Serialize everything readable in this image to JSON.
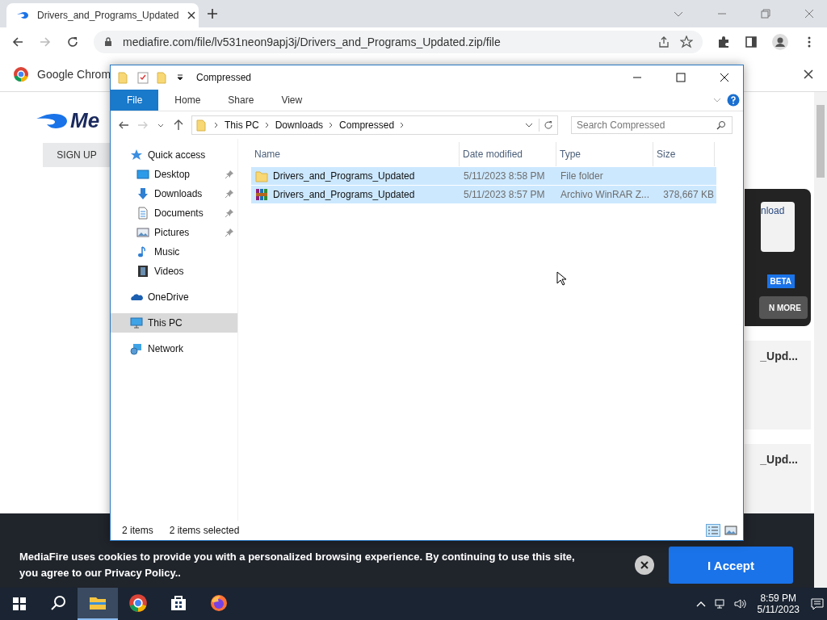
{
  "browser": {
    "tab": {
      "title": "Drivers_and_Programs_Updated"
    },
    "url": "mediafire.com/file/lv531neon9apj3j/Drivers_and_Programs_Updated.zip/file",
    "infobar": "Google Chrom"
  },
  "page": {
    "logo": "Me",
    "signup": "SIGN UP",
    "download": "nload",
    "beta": "BETA",
    "more": "N MORE",
    "cards": [
      {
        "name": "_Upd..."
      },
      {
        "name": "_Upd..."
      }
    ],
    "cookie": {
      "text": "MediaFire uses cookies to provide you with a personalized browsing experience. By continuing to use this site, you agree to our Privacy Policy..",
      "accept": "I Accept"
    }
  },
  "explorer": {
    "title": "Compressed",
    "ribbon_tabs": [
      {
        "label": "File",
        "selected": true
      },
      {
        "label": "Home",
        "selected": false
      },
      {
        "label": "Share",
        "selected": false
      },
      {
        "label": "View",
        "selected": false
      }
    ],
    "breadcrumb": [
      "This PC",
      "Downloads",
      "Compressed"
    ],
    "search": {
      "placeholder": "Search Compressed"
    },
    "nav": [
      {
        "label": "Quick access",
        "kind": "star",
        "selected": false,
        "children": [
          {
            "label": "Desktop",
            "kind": "desktop",
            "pinned": true,
            "selected": false
          },
          {
            "label": "Downloads",
            "kind": "download",
            "pinned": true,
            "selected": false
          },
          {
            "label": "Documents",
            "kind": "document",
            "pinned": true,
            "selected": false
          },
          {
            "label": "Pictures",
            "kind": "picture",
            "pinned": true,
            "selected": false
          },
          {
            "label": "Music",
            "kind": "music",
            "pinned": false,
            "selected": false
          },
          {
            "label": "Videos",
            "kind": "video",
            "pinned": false,
            "selected": false
          }
        ]
      },
      {
        "label": "OneDrive",
        "kind": "cloud",
        "selected": false
      },
      {
        "label": "This PC",
        "kind": "pc",
        "selected": true
      },
      {
        "label": "Network",
        "kind": "network",
        "selected": false
      }
    ],
    "columns": [
      "Name",
      "Date modified",
      "Type",
      "Size"
    ],
    "rows": [
      {
        "kind": "folder",
        "name": "Drivers_and_Programs_Updated",
        "date": "5/11/2023 8:58 PM",
        "type": "File folder",
        "selected": true
      },
      {
        "kind": "archive",
        "name": "Drivers_and_Programs_Updated",
        "date": "5/11/2023 8:57 PM",
        "type": "Archivo WinRAR Z...",
        "size": "378,667 KB",
        "selected": true
      }
    ],
    "status": {
      "count": "2 items",
      "selection": "2 items selected"
    }
  },
  "taskbar": {
    "apps": [
      {
        "kind": "explorer",
        "selected": true
      },
      {
        "kind": "chrome",
        "selected": false
      },
      {
        "kind": "store",
        "selected": false
      },
      {
        "kind": "firefox",
        "selected": false
      }
    ],
    "time": "8:59 PM",
    "date": "5/11/2023"
  }
}
